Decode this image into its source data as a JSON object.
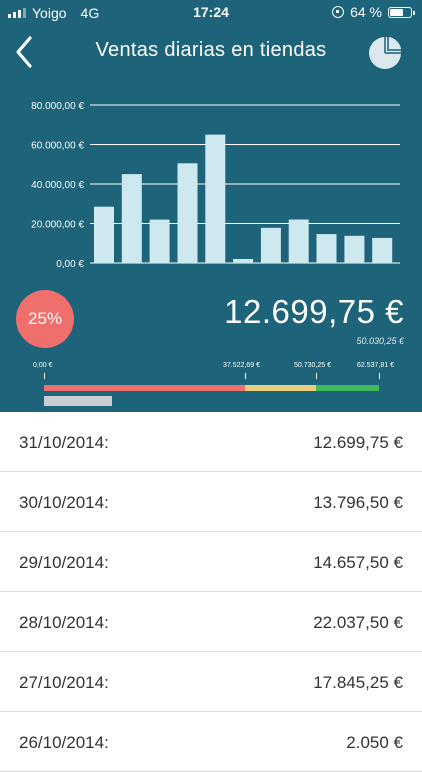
{
  "status_bar": {
    "carrier": "Yoigo",
    "network": "4G",
    "time": "17:24",
    "battery": "64 %"
  },
  "nav": {
    "title": "Ventas diarias en tiendas",
    "back_icon": "chevron-left-icon",
    "pie_icon": "pie-chart-icon"
  },
  "colors": {
    "header_bg": "#1d6379",
    "bar": "#cde8ee",
    "badge": "#ef6f6c",
    "seg_red": "#ef6f6c",
    "seg_yellow": "#e9cf79",
    "seg_green": "#3dbb5a"
  },
  "chart_data": {
    "type": "bar",
    "y_ticks": [
      "80.000,00 €",
      "60.000,00 €",
      "40.000,00 €",
      "20.000,00 €",
      "0,00 €"
    ],
    "ylim": [
      0,
      80000
    ],
    "values": [
      28500,
      45000,
      22000,
      50500,
      65000,
      2050,
      17845.25,
      22037.5,
      14657.5,
      13796.5,
      12699.75
    ],
    "grid": true
  },
  "kpi": {
    "percent": "25%",
    "amount": "12.699,75 €",
    "target": "50.030,25 €",
    "progress_fraction": 0.25
  },
  "scale": {
    "labels": [
      "0,00 €",
      "37.522,69 €",
      "50.730,25 €",
      "62.537,81 €"
    ]
  },
  "rows": [
    {
      "date": "31/10/2014:",
      "amount": "12.699,75 €"
    },
    {
      "date": "30/10/2014:",
      "amount": "13.796,50 €"
    },
    {
      "date": "29/10/2014:",
      "amount": "14.657,50 €"
    },
    {
      "date": "28/10/2014:",
      "amount": "22.037,50 €"
    },
    {
      "date": "27/10/2014:",
      "amount": "17.845,25 €"
    },
    {
      "date": "26/10/2014:",
      "amount": "2.050 €"
    }
  ]
}
